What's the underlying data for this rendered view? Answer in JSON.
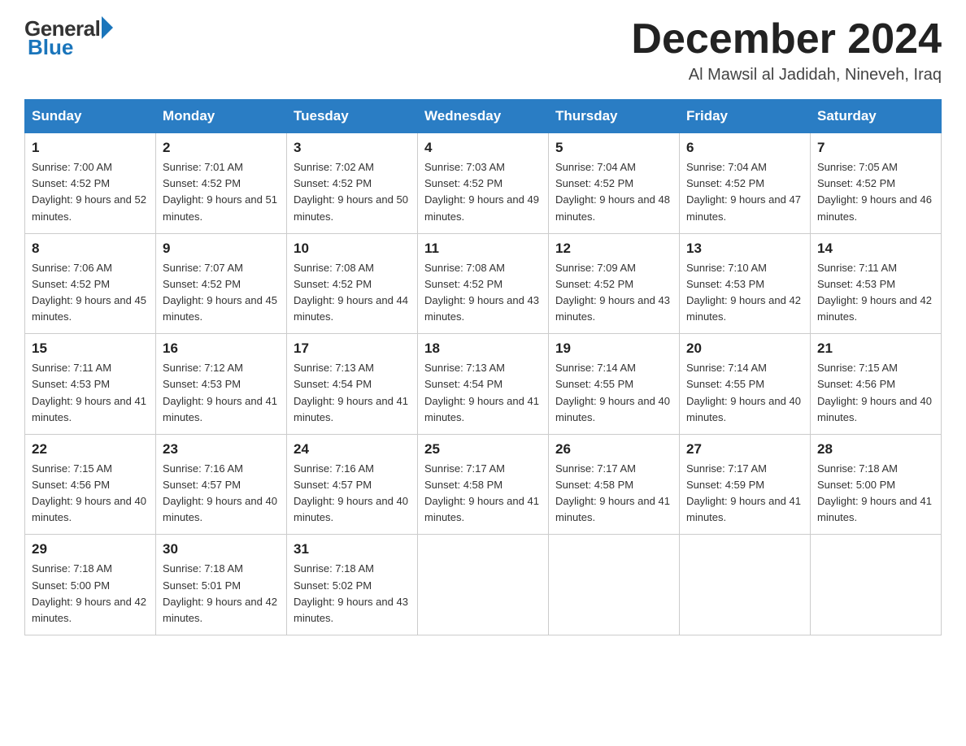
{
  "logo": {
    "general": "General",
    "blue": "Blue"
  },
  "header": {
    "month": "December 2024",
    "location": "Al Mawsil al Jadidah, Nineveh, Iraq"
  },
  "weekdays": [
    "Sunday",
    "Monday",
    "Tuesday",
    "Wednesday",
    "Thursday",
    "Friday",
    "Saturday"
  ],
  "weeks": [
    [
      {
        "day": "1",
        "sunrise": "7:00 AM",
        "sunset": "4:52 PM",
        "daylight": "9 hours and 52 minutes."
      },
      {
        "day": "2",
        "sunrise": "7:01 AM",
        "sunset": "4:52 PM",
        "daylight": "9 hours and 51 minutes."
      },
      {
        "day": "3",
        "sunrise": "7:02 AM",
        "sunset": "4:52 PM",
        "daylight": "9 hours and 50 minutes."
      },
      {
        "day": "4",
        "sunrise": "7:03 AM",
        "sunset": "4:52 PM",
        "daylight": "9 hours and 49 minutes."
      },
      {
        "day": "5",
        "sunrise": "7:04 AM",
        "sunset": "4:52 PM",
        "daylight": "9 hours and 48 minutes."
      },
      {
        "day": "6",
        "sunrise": "7:04 AM",
        "sunset": "4:52 PM",
        "daylight": "9 hours and 47 minutes."
      },
      {
        "day": "7",
        "sunrise": "7:05 AM",
        "sunset": "4:52 PM",
        "daylight": "9 hours and 46 minutes."
      }
    ],
    [
      {
        "day": "8",
        "sunrise": "7:06 AM",
        "sunset": "4:52 PM",
        "daylight": "9 hours and 45 minutes."
      },
      {
        "day": "9",
        "sunrise": "7:07 AM",
        "sunset": "4:52 PM",
        "daylight": "9 hours and 45 minutes."
      },
      {
        "day": "10",
        "sunrise": "7:08 AM",
        "sunset": "4:52 PM",
        "daylight": "9 hours and 44 minutes."
      },
      {
        "day": "11",
        "sunrise": "7:08 AM",
        "sunset": "4:52 PM",
        "daylight": "9 hours and 43 minutes."
      },
      {
        "day": "12",
        "sunrise": "7:09 AM",
        "sunset": "4:52 PM",
        "daylight": "9 hours and 43 minutes."
      },
      {
        "day": "13",
        "sunrise": "7:10 AM",
        "sunset": "4:53 PM",
        "daylight": "9 hours and 42 minutes."
      },
      {
        "day": "14",
        "sunrise": "7:11 AM",
        "sunset": "4:53 PM",
        "daylight": "9 hours and 42 minutes."
      }
    ],
    [
      {
        "day": "15",
        "sunrise": "7:11 AM",
        "sunset": "4:53 PM",
        "daylight": "9 hours and 41 minutes."
      },
      {
        "day": "16",
        "sunrise": "7:12 AM",
        "sunset": "4:53 PM",
        "daylight": "9 hours and 41 minutes."
      },
      {
        "day": "17",
        "sunrise": "7:13 AM",
        "sunset": "4:54 PM",
        "daylight": "9 hours and 41 minutes."
      },
      {
        "day": "18",
        "sunrise": "7:13 AM",
        "sunset": "4:54 PM",
        "daylight": "9 hours and 41 minutes."
      },
      {
        "day": "19",
        "sunrise": "7:14 AM",
        "sunset": "4:55 PM",
        "daylight": "9 hours and 40 minutes."
      },
      {
        "day": "20",
        "sunrise": "7:14 AM",
        "sunset": "4:55 PM",
        "daylight": "9 hours and 40 minutes."
      },
      {
        "day": "21",
        "sunrise": "7:15 AM",
        "sunset": "4:56 PM",
        "daylight": "9 hours and 40 minutes."
      }
    ],
    [
      {
        "day": "22",
        "sunrise": "7:15 AM",
        "sunset": "4:56 PM",
        "daylight": "9 hours and 40 minutes."
      },
      {
        "day": "23",
        "sunrise": "7:16 AM",
        "sunset": "4:57 PM",
        "daylight": "9 hours and 40 minutes."
      },
      {
        "day": "24",
        "sunrise": "7:16 AM",
        "sunset": "4:57 PM",
        "daylight": "9 hours and 40 minutes."
      },
      {
        "day": "25",
        "sunrise": "7:17 AM",
        "sunset": "4:58 PM",
        "daylight": "9 hours and 41 minutes."
      },
      {
        "day": "26",
        "sunrise": "7:17 AM",
        "sunset": "4:58 PM",
        "daylight": "9 hours and 41 minutes."
      },
      {
        "day": "27",
        "sunrise": "7:17 AM",
        "sunset": "4:59 PM",
        "daylight": "9 hours and 41 minutes."
      },
      {
        "day": "28",
        "sunrise": "7:18 AM",
        "sunset": "5:00 PM",
        "daylight": "9 hours and 41 minutes."
      }
    ],
    [
      {
        "day": "29",
        "sunrise": "7:18 AM",
        "sunset": "5:00 PM",
        "daylight": "9 hours and 42 minutes."
      },
      {
        "day": "30",
        "sunrise": "7:18 AM",
        "sunset": "5:01 PM",
        "daylight": "9 hours and 42 minutes."
      },
      {
        "day": "31",
        "sunrise": "7:18 AM",
        "sunset": "5:02 PM",
        "daylight": "9 hours and 43 minutes."
      },
      null,
      null,
      null,
      null
    ]
  ]
}
